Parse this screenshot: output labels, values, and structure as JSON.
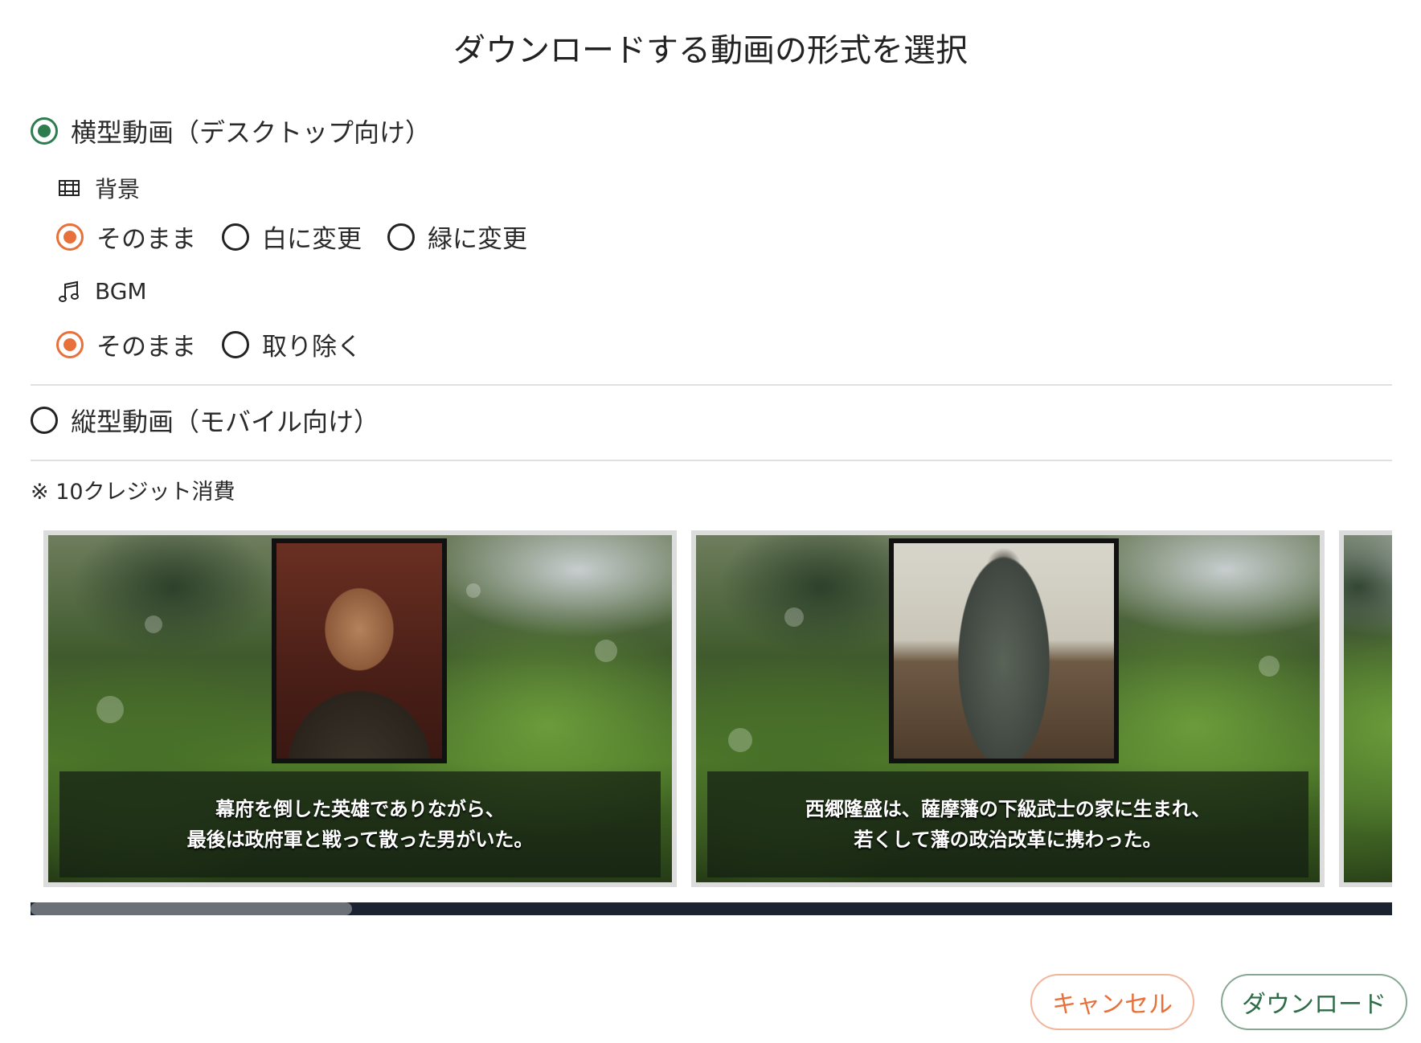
{
  "dialog": {
    "title": "ダウンロードする動画の形式を選択"
  },
  "formats": {
    "horizontal": {
      "label": "横型動画（デスクトップ向け）",
      "selected": true
    },
    "vertical": {
      "label": "縦型動画（モバイル向け）",
      "selected": false
    }
  },
  "background": {
    "heading": "背景",
    "icon": "film-icon",
    "options": [
      {
        "label": "そのまま",
        "selected": true
      },
      {
        "label": "白に変更",
        "selected": false
      },
      {
        "label": "緑に変更",
        "selected": false
      }
    ]
  },
  "bgm": {
    "heading": "BGM",
    "icon": "music-note-icon",
    "options": [
      {
        "label": "そのまま",
        "selected": true
      },
      {
        "label": "取り除く",
        "selected": false
      }
    ]
  },
  "note": "※ 10クレジット消費",
  "slides": [
    {
      "caption_line1": "幕府を倒した英雄でありながら、",
      "caption_line2": "最後は政府軍と戦って散った男がいた。"
    },
    {
      "caption_line1": "西郷隆盛は、薩摩藩の下級武士の家に生まれ、",
      "caption_line2": "若くして藩の政治改革に携わった。"
    }
  ],
  "scroll": {
    "position_fraction": 0.0,
    "visible_fraction": 0.236
  },
  "buttons": {
    "cancel": "キャンセル",
    "download": "ダウンロード"
  },
  "colors": {
    "accent_green": "#2e7d4f",
    "accent_orange": "#e8703a"
  }
}
